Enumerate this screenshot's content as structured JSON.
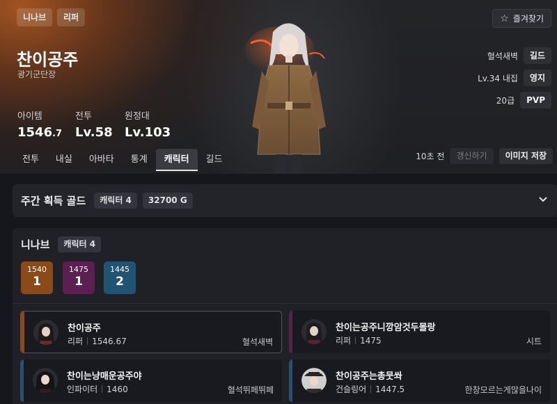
{
  "header": {
    "server_tag": "니나브",
    "class_tag": "리퍼",
    "favorite_label": "즐겨찾기",
    "name": "찬이공주",
    "title": "광기군단장",
    "stats": {
      "item_label": "아이템",
      "item_value_main": "1546",
      "item_value_decimal": ".7",
      "combat_label": "전투",
      "combat_value": "Lv.58",
      "expedition_label": "원정대",
      "expedition_value": "Lv.103"
    },
    "guild_name": "혈석새벽",
    "guild_chip": "길드",
    "estate_text": "Lv.34 내집",
    "estate_chip": "영지",
    "pvp_text": "20급",
    "pvp_chip": "PVP"
  },
  "tabs": [
    {
      "label": "전투",
      "active": false
    },
    {
      "label": "내실",
      "active": false
    },
    {
      "label": "아바타",
      "active": false
    },
    {
      "label": "통계",
      "active": false
    },
    {
      "label": "캐릭터",
      "active": true
    },
    {
      "label": "길드",
      "active": false
    }
  ],
  "refresh": {
    "ago": "10초 전",
    "refresh_label": "갱신하기",
    "save_image_label": "이미지 저장"
  },
  "weekly_gold": {
    "title": "주간 획득 골드",
    "characters": "캐릭터 4",
    "amount": "32700 G"
  },
  "roster": {
    "server": "니나브",
    "count_chip": "캐릭터 4",
    "level_groups": [
      {
        "level": "1540",
        "count": "1",
        "color": "#8a4a1a"
      },
      {
        "level": "1475",
        "count": "1",
        "color": "#5c1f52"
      },
      {
        "level": "1445",
        "count": "2",
        "color": "#215473"
      }
    ],
    "characters": [
      {
        "name": "찬이공주",
        "class": "리퍼",
        "item_level": "1546.67",
        "guild": "혈석새벽",
        "stripe": "#8a4a1a"
      },
      {
        "name": "찬이는공주니깡암것두몰랑",
        "class": "리퍼",
        "item_level": "1475",
        "guild": "시트",
        "stripe": "#5c1f52"
      },
      {
        "name": "찬이는냥매운공주야",
        "class": "인파이터",
        "item_level": "1460",
        "guild": "혈석뛰페뛰페",
        "stripe": "#215473"
      },
      {
        "name": "찬이공주는총뭇쏴",
        "class": "건슬링어",
        "item_level": "1447.5",
        "guild": "한창모르는게많을나이",
        "stripe": "#215473"
      }
    ]
  },
  "colors": {
    "accent_orange": "#8a4a1a",
    "accent_purple": "#5c1f52",
    "accent_blue": "#215473"
  }
}
